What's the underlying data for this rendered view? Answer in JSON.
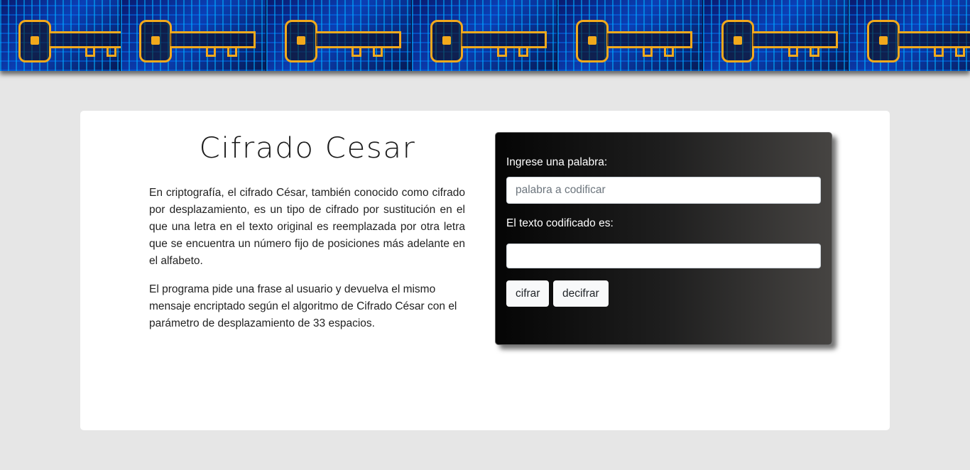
{
  "banner": {
    "tiles": 7,
    "alt": ""
  },
  "main": {
    "title": "Cifrado Cesar",
    "paragraph1": "En criptografía, el cifrado César, también conocido como cifrado por desplazamiento, es un tipo de cifrado por sustitución en el que una letra en el texto original es reemplazada por otra letra que se encuentra un número fijo de posiciones más adelante en el alfabeto.",
    "paragraph2": "El programa pide una frase al usuario y devuelva el mismo mensaje encriptado según el algoritmo de Cifrado César con el parámetro de desplazamiento de 33 espacios."
  },
  "form": {
    "input_label": "Ingrese una palabra:",
    "input_placeholder": "palabra a codificar",
    "input_value": "",
    "output_label": "El texto codificado es:",
    "output_value": "",
    "cipher_button": "cifrar",
    "decipher_button": "decifrar"
  },
  "colors": {
    "page_background": "#e6e6e6",
    "card_background": "#ffffff",
    "panel_gradient_start": "#050505",
    "panel_gradient_end": "#464442",
    "banner_key_accent": "#f2a91c",
    "banner_circuit": "#0fb6ff"
  }
}
